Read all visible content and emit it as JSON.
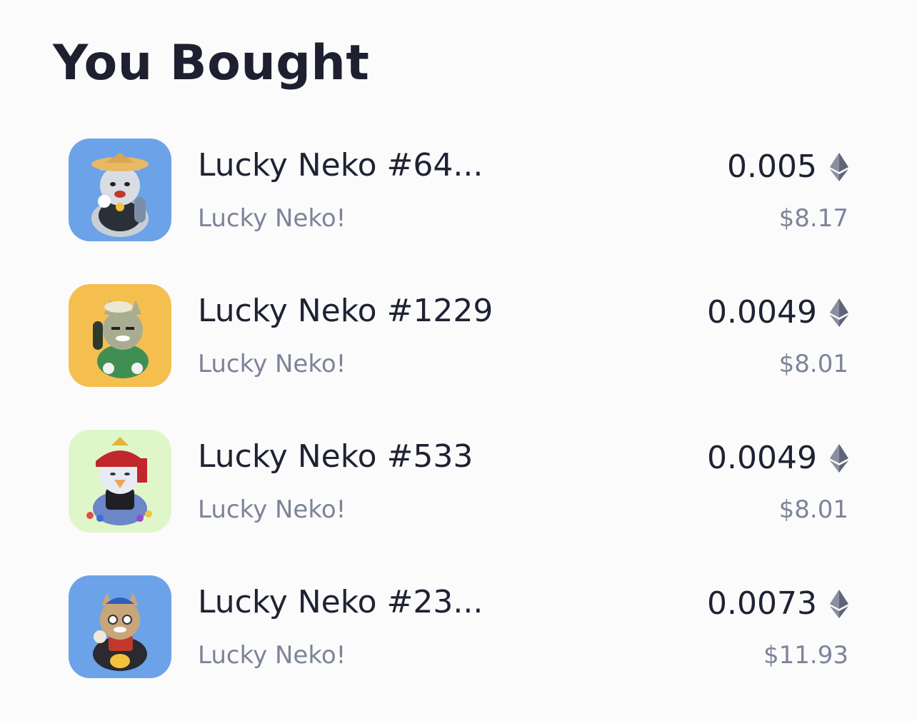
{
  "header": {
    "title": "You Bought"
  },
  "items": [
    {
      "name": "Lucky Neko #64...",
      "collection": "Lucky Neko!",
      "price_eth": "0.005",
      "price_usd": "$8.17",
      "thumb_bg": "#6ca3e8",
      "currency_icon": "ethereum-icon"
    },
    {
      "name": "Lucky Neko #1229",
      "collection": "Lucky Neko!",
      "price_eth": "0.0049",
      "price_usd": "$8.01",
      "thumb_bg": "#f5bf4f",
      "currency_icon": "ethereum-icon"
    },
    {
      "name": "Lucky Neko #533",
      "collection": "Lucky Neko!",
      "price_eth": "0.0049",
      "price_usd": "$8.01",
      "thumb_bg": "#dff7c8",
      "currency_icon": "ethereum-icon"
    },
    {
      "name": "Lucky Neko #23...",
      "collection": "Lucky Neko!",
      "price_eth": "0.0073",
      "price_usd": "$11.93",
      "thumb_bg": "#6ca3e8",
      "currency_icon": "ethereum-icon"
    }
  ]
}
